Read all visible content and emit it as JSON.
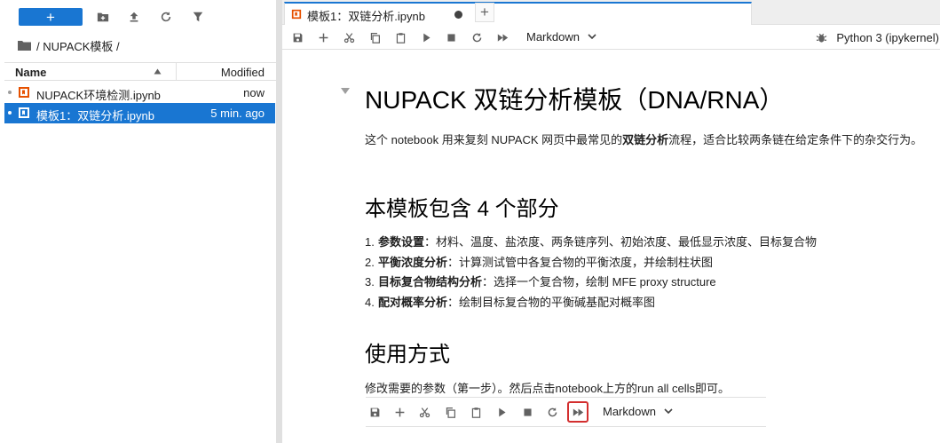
{
  "file_browser": {
    "new_label": "+",
    "breadcrumb": "/ NUPACK模板 /",
    "columns": {
      "name": "Name",
      "modified": "Modified"
    },
    "files": [
      {
        "name": "NUPACK环境检测.ipynb",
        "modified": "now"
      },
      {
        "name": "模板1：双链分析.ipynb",
        "modified": "5 min. ago"
      }
    ]
  },
  "notebook": {
    "tab_label": "模板1：双链分析.ipynb",
    "add_tab_label": "+",
    "cell_type": "Markdown",
    "kernel": "Python 3 (ipykernel)",
    "heading1": "NUPACK 双链分析模板（DNA/RNA）",
    "intro_pre": "这个 notebook 用来复刻 NUPACK 网页中最常见的",
    "intro_bold": "双链分析",
    "intro_post": "流程，适合比较两条链在给定条件下的杂交行为。",
    "heading2a": "本模板包含 4 个部分",
    "list": [
      {
        "num": "1.",
        "bold": "参数设置",
        "text": "：材料、温度、盐浓度、两条链序列、初始浓度、最低显示浓度、目标复合物"
      },
      {
        "num": "2.",
        "bold": "平衡浓度分析",
        "text": "：计算测试管中各复合物的平衡浓度，并绘制柱状图"
      },
      {
        "num": "3.",
        "bold": "目标复合物结构分析",
        "text": "：选择一个复合物，绘制 MFE proxy structure"
      },
      {
        "num": "4.",
        "bold": "配对概率分析",
        "text": "：绘制目标复合物的平衡碱基配对概率图"
      }
    ],
    "heading2b": "使用方式",
    "usage": "修改需要的参数（第一步）。然后点击notebook上方的run all cells即可。",
    "cell_toolbar_type": "Markdown"
  },
  "colors": {
    "accent": "#1976d2",
    "highlight": "#d32f2f",
    "notebook_icon": "#e65100"
  }
}
